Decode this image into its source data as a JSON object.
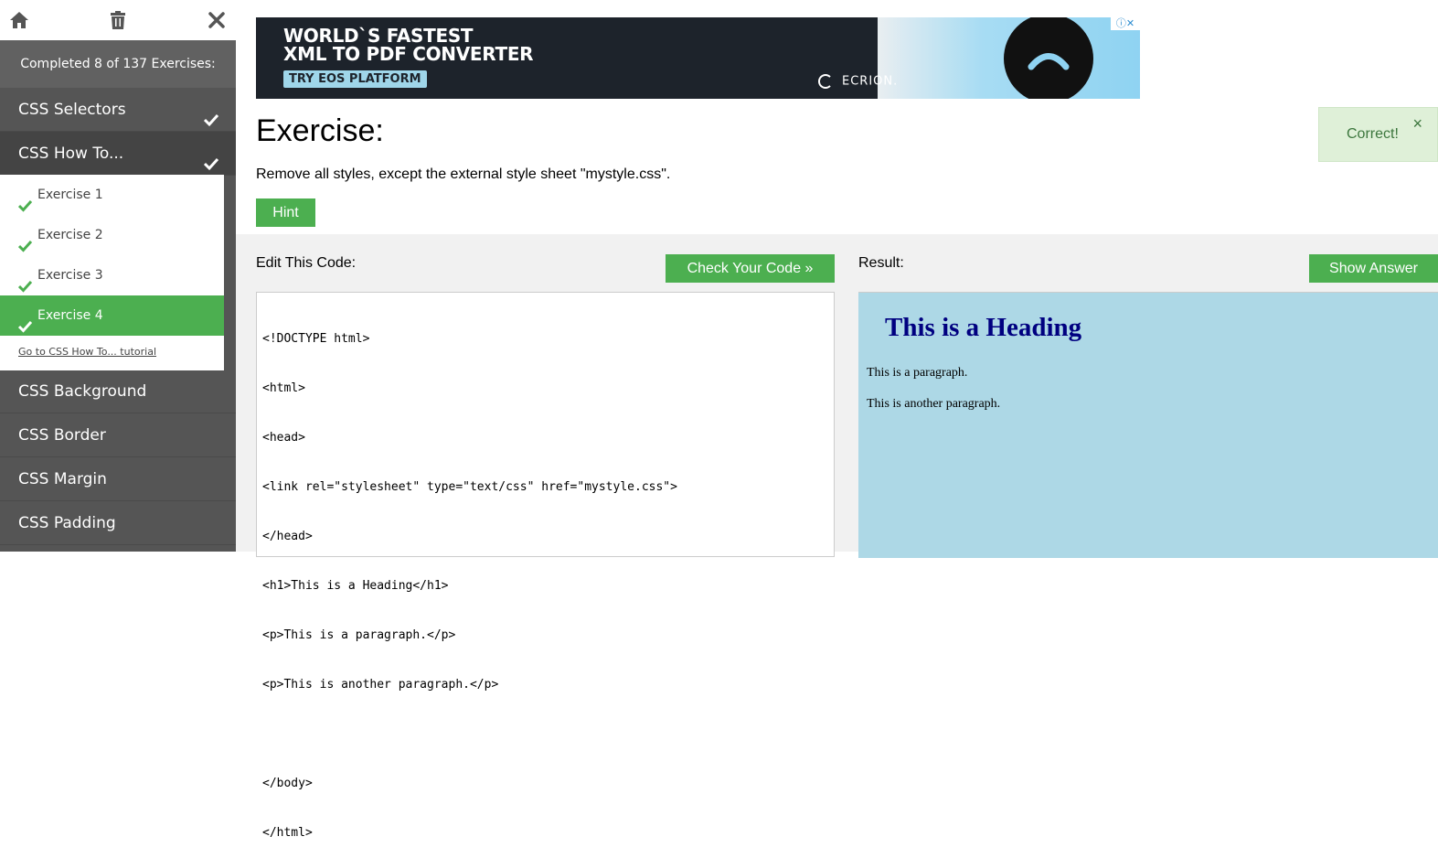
{
  "colors": {
    "accent": "#4CAF50",
    "sidebar": "#555555",
    "result_bg": "#add8e6",
    "heading": "#000080"
  },
  "sidebar": {
    "icons": [
      "home-icon",
      "trash-icon",
      "close-icon"
    ],
    "completed": "Completed 8 of 137 Exercises:",
    "sections_top": [
      "CSS Selectors",
      "CSS How To..."
    ],
    "exercises": [
      "Exercise 1",
      "Exercise 2",
      "Exercise 3",
      "Exercise 4"
    ],
    "active_exercise": "Exercise 4",
    "tutorial_link": "Go to CSS How To... tutorial",
    "sections_bottom": [
      "CSS Background",
      "CSS Border",
      "CSS Margin",
      "CSS Padding"
    ]
  },
  "ad": {
    "line1": "WORLD`S FASTEST",
    "line2": "XML TO PDF CONVERTER",
    "button": "TRY EOS PLATFORM",
    "brand": "ECRION."
  },
  "main": {
    "title": "Exercise:",
    "instruction": "Remove all styles, except the external style sheet \"mystyle.css\".",
    "hint": "Hint",
    "toast": "Correct!",
    "toast_close": "×"
  },
  "editor": {
    "label": "Edit This Code:",
    "check_button": "Check Your Code »",
    "lines": [
      "<!DOCTYPE html>",
      "<html>",
      "<head>",
      "<link rel=\"stylesheet\" type=\"text/css\" href=\"mystyle.css\">",
      "</head>",
      "<h1>This is a Heading</h1>",
      "<p>This is a paragraph.</p>",
      "<p>This is another paragraph.</p>",
      "",
      "</body>",
      "</html>"
    ]
  },
  "result": {
    "label": "Result:",
    "show_answer": "Show Answer",
    "heading": "This is a Heading",
    "p1": "This is a paragraph.",
    "p2": "This is another paragraph."
  }
}
